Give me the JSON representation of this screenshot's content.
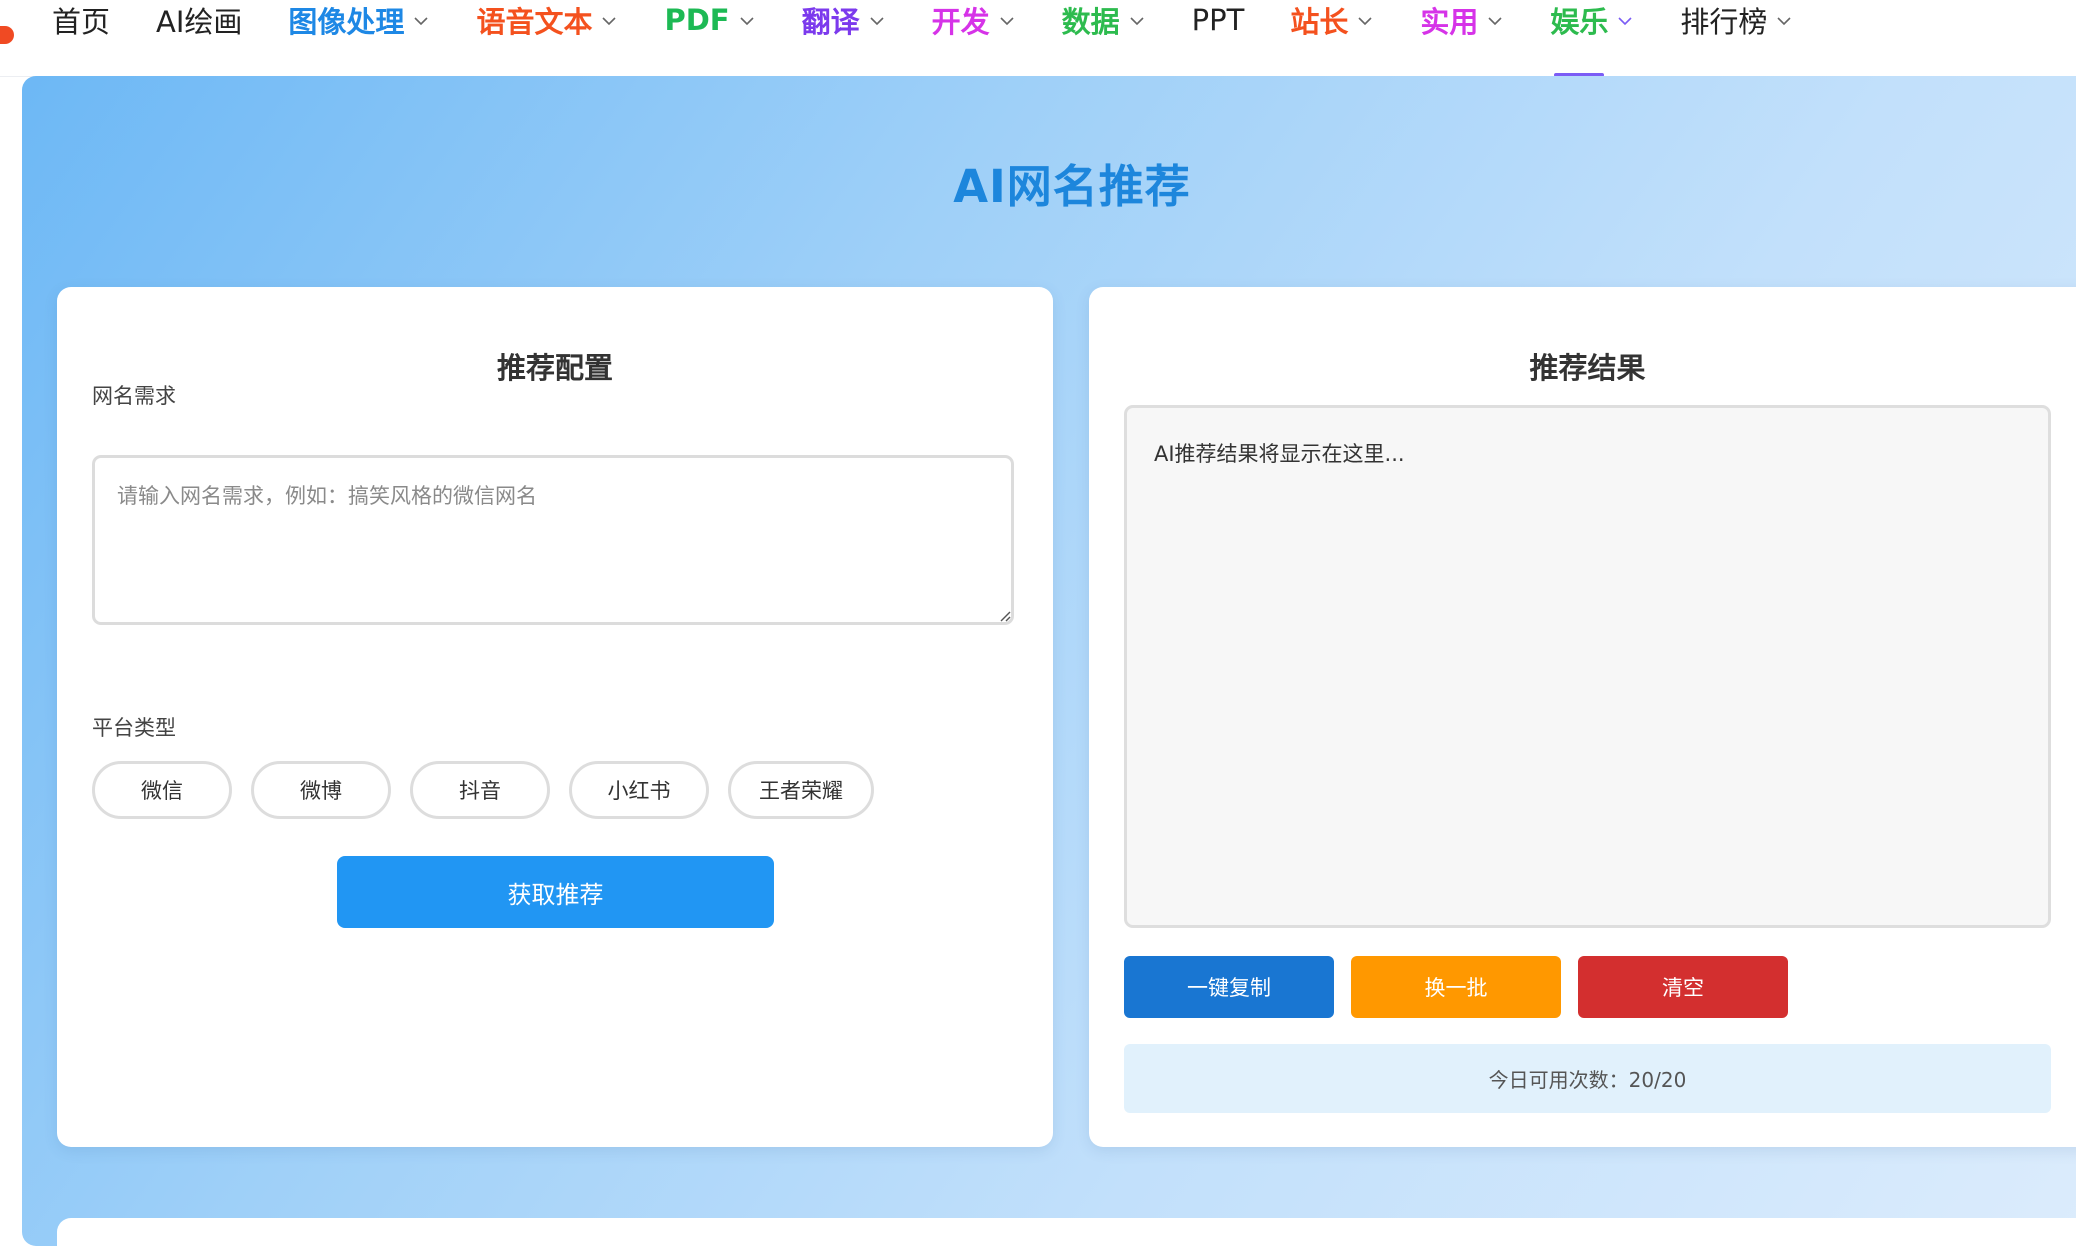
{
  "nav": {
    "items": [
      {
        "label": "首页",
        "color": "#222222",
        "bold": false,
        "dropdown": false
      },
      {
        "label": "AI绘画",
        "color": "#222222",
        "bold": false,
        "dropdown": false
      },
      {
        "label": "图像处理",
        "color": "#1e88e5",
        "bold": true,
        "dropdown": true
      },
      {
        "label": "语音文本",
        "color": "#f4511e",
        "bold": true,
        "dropdown": true
      },
      {
        "label": "PDF",
        "color": "#1db954",
        "bold": true,
        "dropdown": true
      },
      {
        "label": "翻译",
        "color": "#7c3aed",
        "bold": true,
        "dropdown": true
      },
      {
        "label": "开发",
        "color": "#d633e8",
        "bold": true,
        "dropdown": true
      },
      {
        "label": "数据",
        "color": "#2dbb4e",
        "bold": true,
        "dropdown": true
      },
      {
        "label": "PPT",
        "color": "#222222",
        "bold": false,
        "dropdown": false
      },
      {
        "label": "站长",
        "color": "#f4511e",
        "bold": true,
        "dropdown": true
      },
      {
        "label": "实用",
        "color": "#d633e8",
        "bold": true,
        "dropdown": true
      },
      {
        "label": "娱乐",
        "color": "#2dbb4e",
        "bold": true,
        "dropdown": true,
        "active": true
      },
      {
        "label": "排行榜",
        "color": "#222222",
        "bold": false,
        "dropdown": true
      }
    ]
  },
  "page": {
    "title": "AI网名推荐"
  },
  "config": {
    "title": "推荐配置",
    "demand_label": "网名需求",
    "demand_placeholder": "请输入网名需求，例如：搞笑风格的微信网名",
    "demand_value": "",
    "platform_label": "平台类型",
    "platforms": [
      "微信",
      "微博",
      "抖音",
      "小红书",
      "王者荣耀"
    ],
    "submit_label": "获取推荐"
  },
  "result": {
    "title": "推荐结果",
    "placeholder": "AI推荐结果将显示在这里...",
    "copy_label": "一键复制",
    "refresh_label": "换一批",
    "clear_label": "清空",
    "quota_text": "今日可用次数：20/20"
  },
  "colors": {
    "title_blue": "#1d86dc",
    "primary": "#2196f3",
    "copy": "#1976d2",
    "refresh": "#ff9800",
    "clear": "#d32f2f",
    "quota_bg": "#e1f1fc",
    "active_underline": "#7b5cf5"
  }
}
